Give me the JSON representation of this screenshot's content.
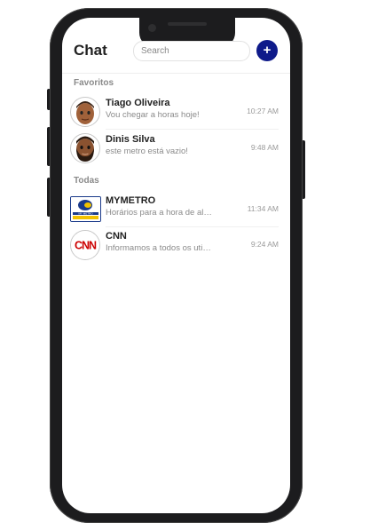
{
  "header": {
    "title": "Chat",
    "search_placeholder": "Search",
    "add_label": "+"
  },
  "favorites": {
    "label": "Favoritos",
    "items": [
      {
        "name": "Tiago Oliveira",
        "message": "Vou chegar a horas hoje!",
        "time": "10:27 AM",
        "avatar": "emoji-avatar-man"
      },
      {
        "name": "Dinis Silva",
        "message": "este metro está vazio!",
        "time": "9:48 AM",
        "avatar": "emoji-avatar-bearded-man"
      }
    ]
  },
  "all": {
    "label": "Todas",
    "items": [
      {
        "name": "MYMETRO",
        "message": "Horários para a hora de almoço",
        "time": "11:34 AM",
        "avatar": "mymetro-logo"
      },
      {
        "name": "CNN",
        "message": "Informamos a todos os utilizadores",
        "time": "9:24 AM",
        "avatar": "cnn-logo"
      }
    ]
  },
  "logos": {
    "mymetro": "MY METRO",
    "cnn": "CNN"
  },
  "colors": {
    "accent": "#0e1a8a",
    "cnn_red": "#cc0000"
  }
}
